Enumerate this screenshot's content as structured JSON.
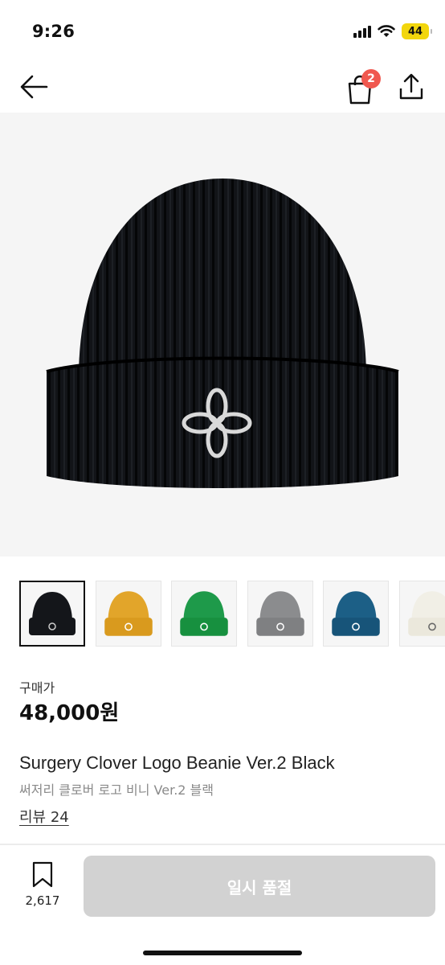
{
  "status_bar": {
    "time": "9:26",
    "battery": "44"
  },
  "nav": {
    "cart_badge": "2"
  },
  "gallery": {
    "thumbnails": [
      {
        "color_name": "black",
        "hex": "#14161a",
        "selected": true
      },
      {
        "color_name": "yellow",
        "hex": "#e2a52a",
        "selected": false
      },
      {
        "color_name": "green",
        "hex": "#1e9a4a",
        "selected": false
      },
      {
        "color_name": "gray",
        "hex": "#8b8c8e",
        "selected": false
      },
      {
        "color_name": "blue",
        "hex": "#1c5f86",
        "selected": false
      },
      {
        "color_name": "white",
        "hex": "#f1efe6",
        "selected": false
      }
    ]
  },
  "product": {
    "price_label": "구매가",
    "price": "48,000원",
    "title": "Surgery Clover Logo Beanie Ver.2 Black",
    "subtitle": "써저리 클로버 로고 비니 Ver.2 블랙",
    "reviews": "리뷰 24"
  },
  "bottom_bar": {
    "bookmark_count": "2,617",
    "buy_label": "일시 품절"
  },
  "colors": {
    "badge": "#f0584f",
    "disabled_button": "#d2d2d2"
  }
}
